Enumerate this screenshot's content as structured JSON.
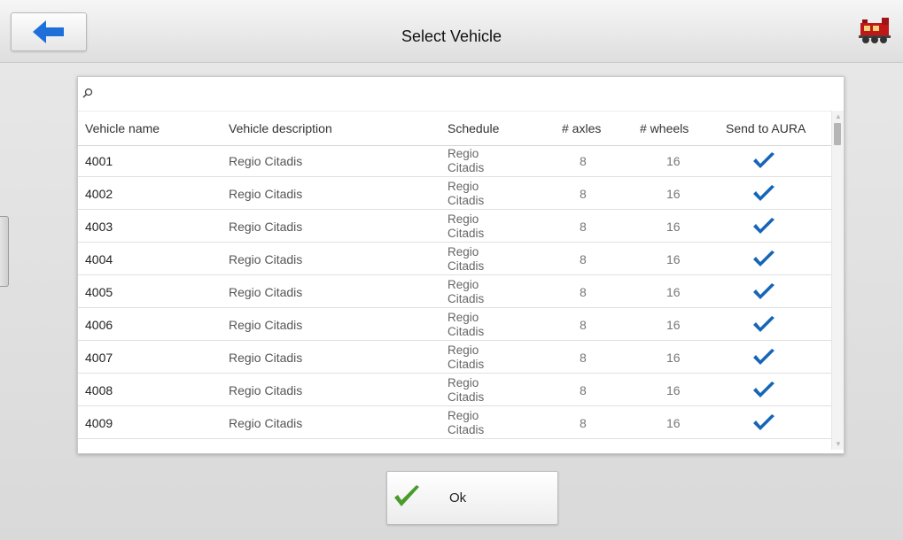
{
  "header": {
    "title": "Select Vehicle",
    "back_icon": "arrow-left-icon",
    "app_icon": "train-icon",
    "accent_color": "#1e6fd9"
  },
  "search": {
    "placeholder": "",
    "value": "",
    "icon": "search-icon"
  },
  "table": {
    "columns": [
      "Vehicle name",
      "Vehicle description",
      "Schedule",
      "# axles",
      "# wheels",
      "Send to AURA"
    ],
    "rows": [
      {
        "name": "4001",
        "description": "Regio Citadis",
        "schedule_line1": "Regio",
        "schedule_line2": "Citadis",
        "axles": "8",
        "wheels": "16",
        "send_to_aura": true
      },
      {
        "name": "4002",
        "description": "Regio Citadis",
        "schedule_line1": "Regio",
        "schedule_line2": "Citadis",
        "axles": "8",
        "wheels": "16",
        "send_to_aura": true
      },
      {
        "name": "4003",
        "description": "Regio Citadis",
        "schedule_line1": "Regio",
        "schedule_line2": "Citadis",
        "axles": "8",
        "wheels": "16",
        "send_to_aura": true
      },
      {
        "name": "4004",
        "description": "Regio Citadis",
        "schedule_line1": "Regio",
        "schedule_line2": "Citadis",
        "axles": "8",
        "wheels": "16",
        "send_to_aura": true
      },
      {
        "name": "4005",
        "description": "Regio Citadis",
        "schedule_line1": "Regio",
        "schedule_line2": "Citadis",
        "axles": "8",
        "wheels": "16",
        "send_to_aura": true
      },
      {
        "name": "4006",
        "description": "Regio Citadis",
        "schedule_line1": "Regio",
        "schedule_line2": "Citadis",
        "axles": "8",
        "wheels": "16",
        "send_to_aura": true
      },
      {
        "name": "4007",
        "description": "Regio Citadis",
        "schedule_line1": "Regio",
        "schedule_line2": "Citadis",
        "axles": "8",
        "wheels": "16",
        "send_to_aura": true
      },
      {
        "name": "4008",
        "description": "Regio Citadis",
        "schedule_line1": "Regio",
        "schedule_line2": "Citadis",
        "axles": "8",
        "wheels": "16",
        "send_to_aura": true
      },
      {
        "name": "4009",
        "description": "Regio Citadis",
        "schedule_line1": "Regio",
        "schedule_line2": "Citadis",
        "axles": "8",
        "wheels": "16",
        "send_to_aura": true
      }
    ],
    "check_icon": "checkmark-icon",
    "check_color": "#1565b8"
  },
  "footer": {
    "ok_label": "Ok",
    "ok_icon": "green-checkmark-icon",
    "ok_icon_color": "#4a9b2a"
  }
}
